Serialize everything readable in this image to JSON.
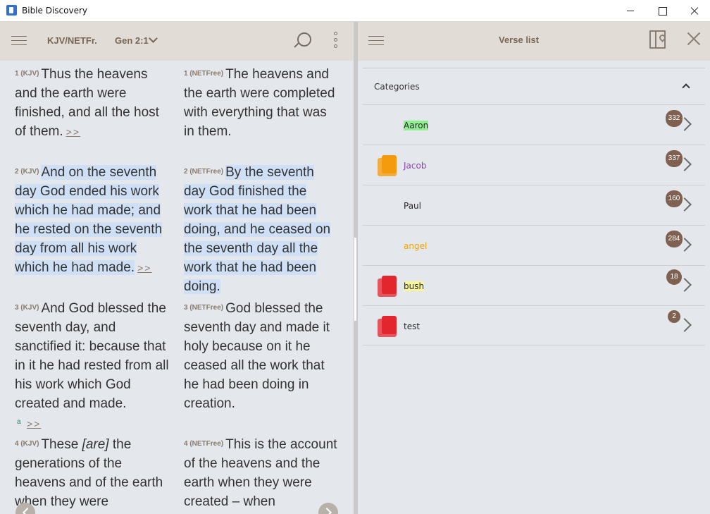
{
  "window": {
    "title": "Bible Discovery"
  },
  "left_panel": {
    "version": "KJV/NETFr.",
    "reference": "Gen 2:1",
    "verses": {
      "v1_kjv": {
        "num": "1 (KJV)",
        "text": "Thus the heavens and the earth were finished, and all the host of them.",
        "more": ">>"
      },
      "v1_net": {
        "num": "1 (NETFree)",
        "text": "The heavens and the earth were completed with everything that was in them."
      },
      "v2_kjv": {
        "num": "2 (KJV)",
        "text": "And on the seventh day God ended his work which he had made; and he rested on the seventh day from all his work which he had made.",
        "more": ">>"
      },
      "v2_net": {
        "num": "2 (NETFree)",
        "text": "By the seventh day God finished the work that he had been doing, and he ceased on the seventh day all the work that he had been doing."
      },
      "v3_kjv": {
        "num": "3 (KJV)",
        "text": "And God blessed the seventh day, and sanctified it: because that in it he had rested from all his work which God created and made."
      },
      "v3_net": {
        "num": "3 (NETFree)",
        "text": "God blessed the seventh day and made it holy because on it he ceased all the work that he had been doing in creation."
      },
      "v3_footnote": {
        "mark": "a",
        "more": ">>"
      },
      "v4_kjv": {
        "num": "4 (KJV)",
        "text_a": "These ",
        "text_b": "[are]",
        "text_c": " the generations of the heavens and of the earth when they were"
      },
      "v4_net": {
        "num": "4 (NETFree)",
        "text": "This is the account of the heavens and the earth when they were created – when"
      }
    }
  },
  "right_panel": {
    "title": "Verse list",
    "categories_label": "Categories",
    "categories": [
      {
        "label": "Aaron",
        "count": "332",
        "color": "#2a2a2a",
        "highlight": "#8ff08f",
        "folder": ""
      },
      {
        "label": "Jacob",
        "count": "337",
        "color": "#8a45b0",
        "highlight": "",
        "folder": "#f39a0d"
      },
      {
        "label": "Paul",
        "count": "160",
        "color": "#2a2a2a",
        "highlight": "",
        "folder": ""
      },
      {
        "label": "angel",
        "count": "284",
        "color": "#f0a500",
        "highlight": "",
        "folder": ""
      },
      {
        "label": "bush",
        "count": "18",
        "color": "#2a2a2a",
        "highlight": "#f9f59a",
        "folder": "#e3262e"
      },
      {
        "label": "test",
        "count": "2",
        "color": "#2a2a2a",
        "highlight": "",
        "folder": "#e3262e"
      }
    ]
  }
}
